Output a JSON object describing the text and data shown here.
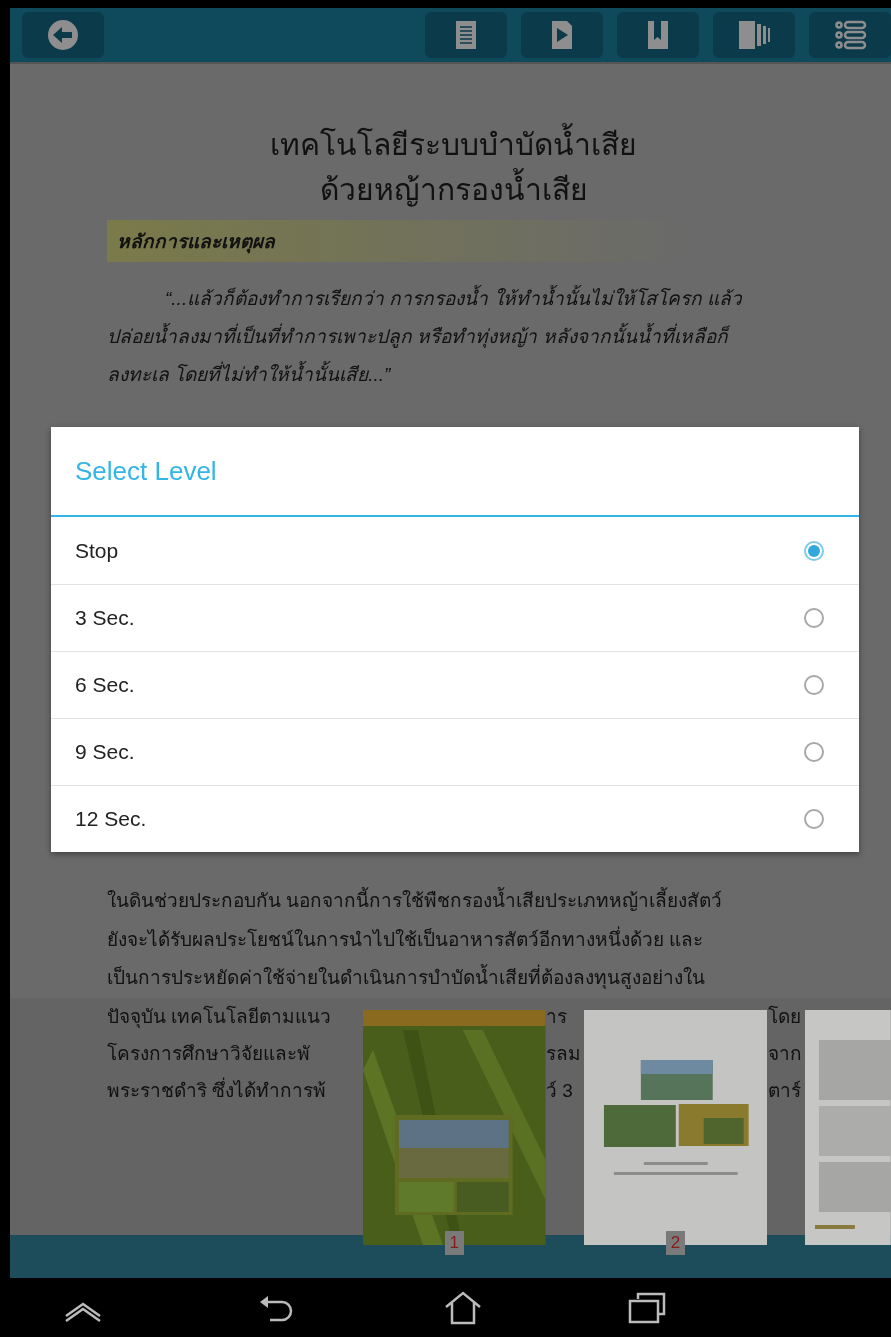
{
  "article": {
    "title_lines": [
      "เทคโนโลยีระบบบำบัดน้ำเสีย",
      "ด้วยหญ้ากรองน้ำเสีย"
    ],
    "heading": "หลักการและเหตุผล",
    "quote_lines": [
      "“...แล้วก็ต้องทำการเรียกว่า การกรองน้ำ ให้ทำน้ำนั้นไม่ให้โสโครก แล้ว",
      "ปล่อยน้ำลงมาที่เป็นที่ทำการเพาะปลูก หรือทำทุ่งหญ้า หลังจากนั้นน้ำที่เหลือก็",
      "ลงทะเล โดยที่ไม่ทำให้น้ำนั้นเสีย...”"
    ],
    "body_lines": [
      "ในดินช่วยประกอบกัน นอกจากนี้การใช้พืชกรองน้ำเสียประเภทหญ้าเลี้ยงสัตว์",
      "ยังจะได้รับผลประโยชน์ในการนำไปใช้เป็นอาหารสัตว์อีกทางหนึ่งด้วย และ",
      "เป็นการประหยัดค่าใช้จ่ายในดำเนินการบำบัดน้ำเสียที่ต้องลงทุนสูงอย่างใน"
    ],
    "covered_lines": [
      {
        "left": "ปัจจุบัน เทคโนโลยีตามแนว",
        "middle": "าร",
        "right": "โดย"
      },
      {
        "left": "โครงการศึกษาวิจัยและพั",
        "middle": "รลม",
        "right": "จาก"
      },
      {
        "left": "พระราชดำริ ซึ่งได้ทำการพ้",
        "middle": "ว์ 3",
        "right": "ตาร์"
      }
    ]
  },
  "dialog": {
    "title": "Select Level",
    "options": [
      {
        "label": "Stop",
        "selected": true
      },
      {
        "label": "3 Sec.",
        "selected": false
      },
      {
        "label": "6 Sec.",
        "selected": false
      },
      {
        "label": "9 Sec.",
        "selected": false
      },
      {
        "label": "12 Sec.",
        "selected": false
      }
    ]
  },
  "thumbnails": [
    {
      "kind": "cover",
      "page": "1"
    },
    {
      "kind": "photos",
      "page": "2"
    },
    {
      "kind": "text"
    }
  ]
}
